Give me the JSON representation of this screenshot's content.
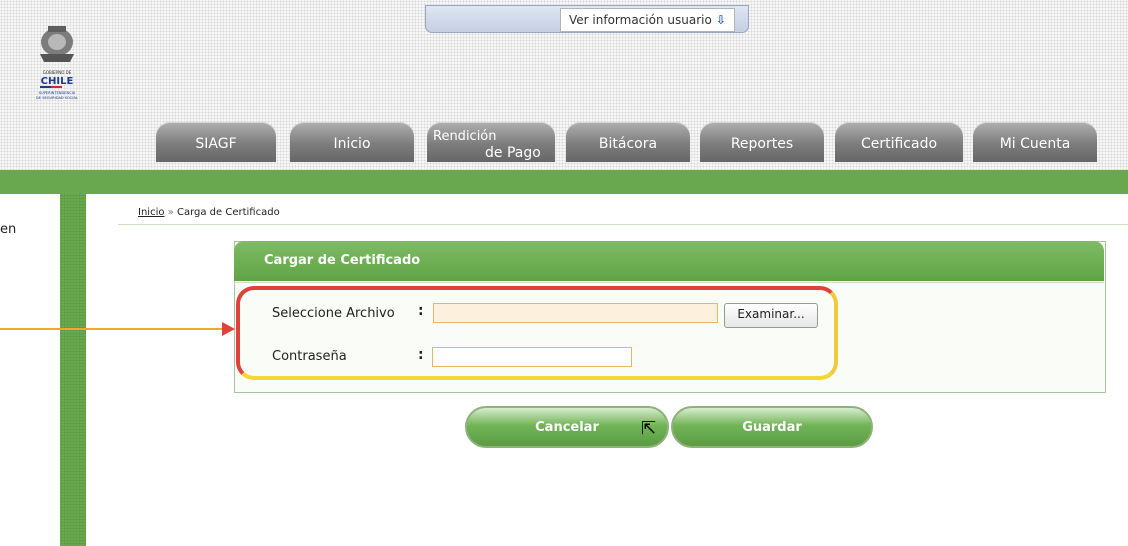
{
  "header": {
    "logo": {
      "line1": "GOBIERNO DE",
      "line2": "CHILE",
      "line3": "SUPERINTENDENCIA",
      "line4": "DE SEGURIDAD SOCIAL"
    },
    "user_link": "Ver información usuario"
  },
  "nav": {
    "tabs": [
      {
        "label": "SIAGF"
      },
      {
        "label": "Inicio"
      },
      {
        "label_top": "Rendición",
        "label_bottom": "de Pago"
      },
      {
        "label": "Bitácora"
      },
      {
        "label": "Reportes"
      },
      {
        "label": "Certificado"
      },
      {
        "label": "Mi Cuenta"
      }
    ]
  },
  "sidebar": {
    "text_fragment": "en"
  },
  "breadcrumb": {
    "home": "Inicio",
    "separator": "»",
    "current": "Carga de Certificado"
  },
  "form": {
    "title": "Cargar de Certificado",
    "file_label": "Seleccione Archivo",
    "password_label": "Contraseña",
    "colon": ":",
    "browse_label": "Examinar...",
    "file_value": "",
    "password_value": ""
  },
  "buttons": {
    "cancel": "Cancelar",
    "save": "Guardar"
  },
  "colors": {
    "green": "#6aa84f",
    "highlight_red": "#e0413a",
    "highlight_yellow": "#f5d733",
    "arrow_orange": "#f4a52a"
  }
}
